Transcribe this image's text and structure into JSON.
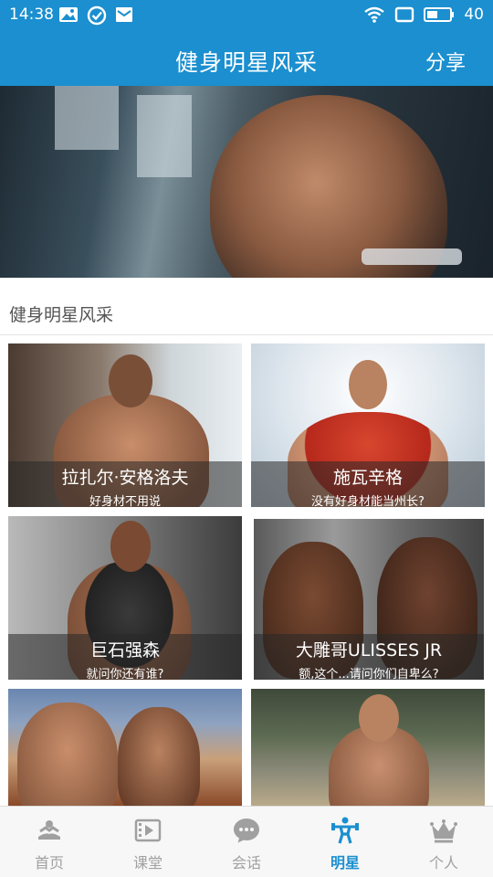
{
  "status_bar": {
    "time": "14:38",
    "battery_level": "40",
    "left_icons": [
      "image-icon",
      "check-circle-icon",
      "mail-icon"
    ],
    "right_icons": [
      "wifi-icon",
      "screen-rotate-icon",
      "battery-icon"
    ]
  },
  "app_bar": {
    "title": "健身明星风采",
    "share_label": "分享"
  },
  "section": {
    "title": "健身明星风采"
  },
  "stars": [
    {
      "name": "拉扎尔·安格洛夫",
      "quote": "好身材不用说"
    },
    {
      "name": "施瓦辛格",
      "quote": "没有好身材能当州长?"
    },
    {
      "name": "巨石强森",
      "quote": "就问你还有谁?"
    },
    {
      "name": "大雕哥ULISSES JR",
      "quote": "额,这个...请问你们自卑么?"
    },
    {
      "name": "",
      "quote": ""
    },
    {
      "name": "",
      "quote": ""
    }
  ],
  "tabs": [
    {
      "label": "首页",
      "icon": "home-dumbbell-icon",
      "active": false
    },
    {
      "label": "课堂",
      "icon": "video-icon",
      "active": false
    },
    {
      "label": "会话",
      "icon": "chat-icon",
      "active": false
    },
    {
      "label": "明星",
      "icon": "athlete-icon",
      "active": true
    },
    {
      "label": "个人",
      "icon": "crown-icon",
      "active": false
    }
  ],
  "colors": {
    "primary": "#1b8fcf",
    "tab_inactive": "#a0a0a0",
    "caption_overlay": "rgba(40,40,40,0.55)"
  }
}
